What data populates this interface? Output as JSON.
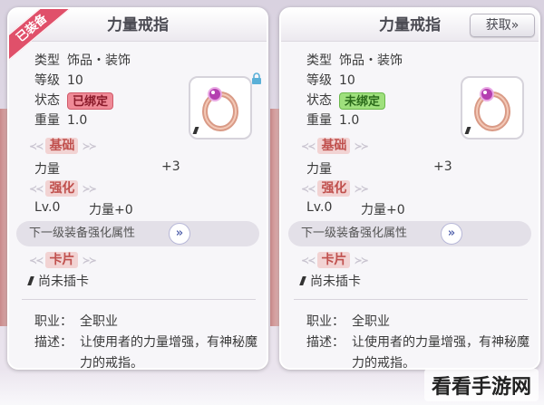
{
  "left_card": {
    "header": "力量戒指",
    "ribbon": "已装备",
    "info": [
      {
        "k": "类型",
        "v": "饰品・装饰"
      },
      {
        "k": "等级",
        "v": "10"
      },
      {
        "k": "状态",
        "v": "已绑定"
      },
      {
        "k": "重量",
        "v": "1.0"
      }
    ],
    "section_base": "基础",
    "stat_name": "力量",
    "stat_value": "+3",
    "section_refine": "强化",
    "refine_level": "Lv.0",
    "refine_stat": "力量+0",
    "next_level_label": "下一级装备强化属性",
    "next_level_btn": "»",
    "section_card": "卡片",
    "card_empty": "尚未插卡",
    "job_label": "职业：",
    "job_value": "全职业",
    "desc_label": "描述：",
    "desc_value": "让使用者的力量增强，有神秘魔力的戒指。"
  },
  "right_card": {
    "header": "力量戒指",
    "obtain_button": "获取»",
    "info": [
      {
        "k": "类型",
        "v": "饰品・装饰"
      },
      {
        "k": "等级",
        "v": "10"
      },
      {
        "k": "状态",
        "v": "未绑定"
      },
      {
        "k": "重量",
        "v": "1.0"
      }
    ],
    "section_base": "基础",
    "stat_name": "力量",
    "stat_value": "+3",
    "section_refine": "强化",
    "refine_level": "Lv.0",
    "refine_stat": "力量+0",
    "next_level_label": "下一级装备强化属性",
    "next_level_btn": "»",
    "section_card": "卡片",
    "card_empty": "尚未插卡",
    "job_label": "职业：",
    "job_value": "全职业",
    "desc_label": "描述：",
    "desc_value": "让使用者的力量增强，有神秘魔力的戒指。"
  },
  "watermark": "看看手游网",
  "colors": {
    "bound_badge": "#ef8a97",
    "unbound_badge": "#9fe07d",
    "section_title": "#c0504d",
    "ribbon": "#e0506a"
  },
  "icons": {
    "item": "ring-icon",
    "lock": "lock-icon",
    "next": "double-chevron-right-icon"
  }
}
